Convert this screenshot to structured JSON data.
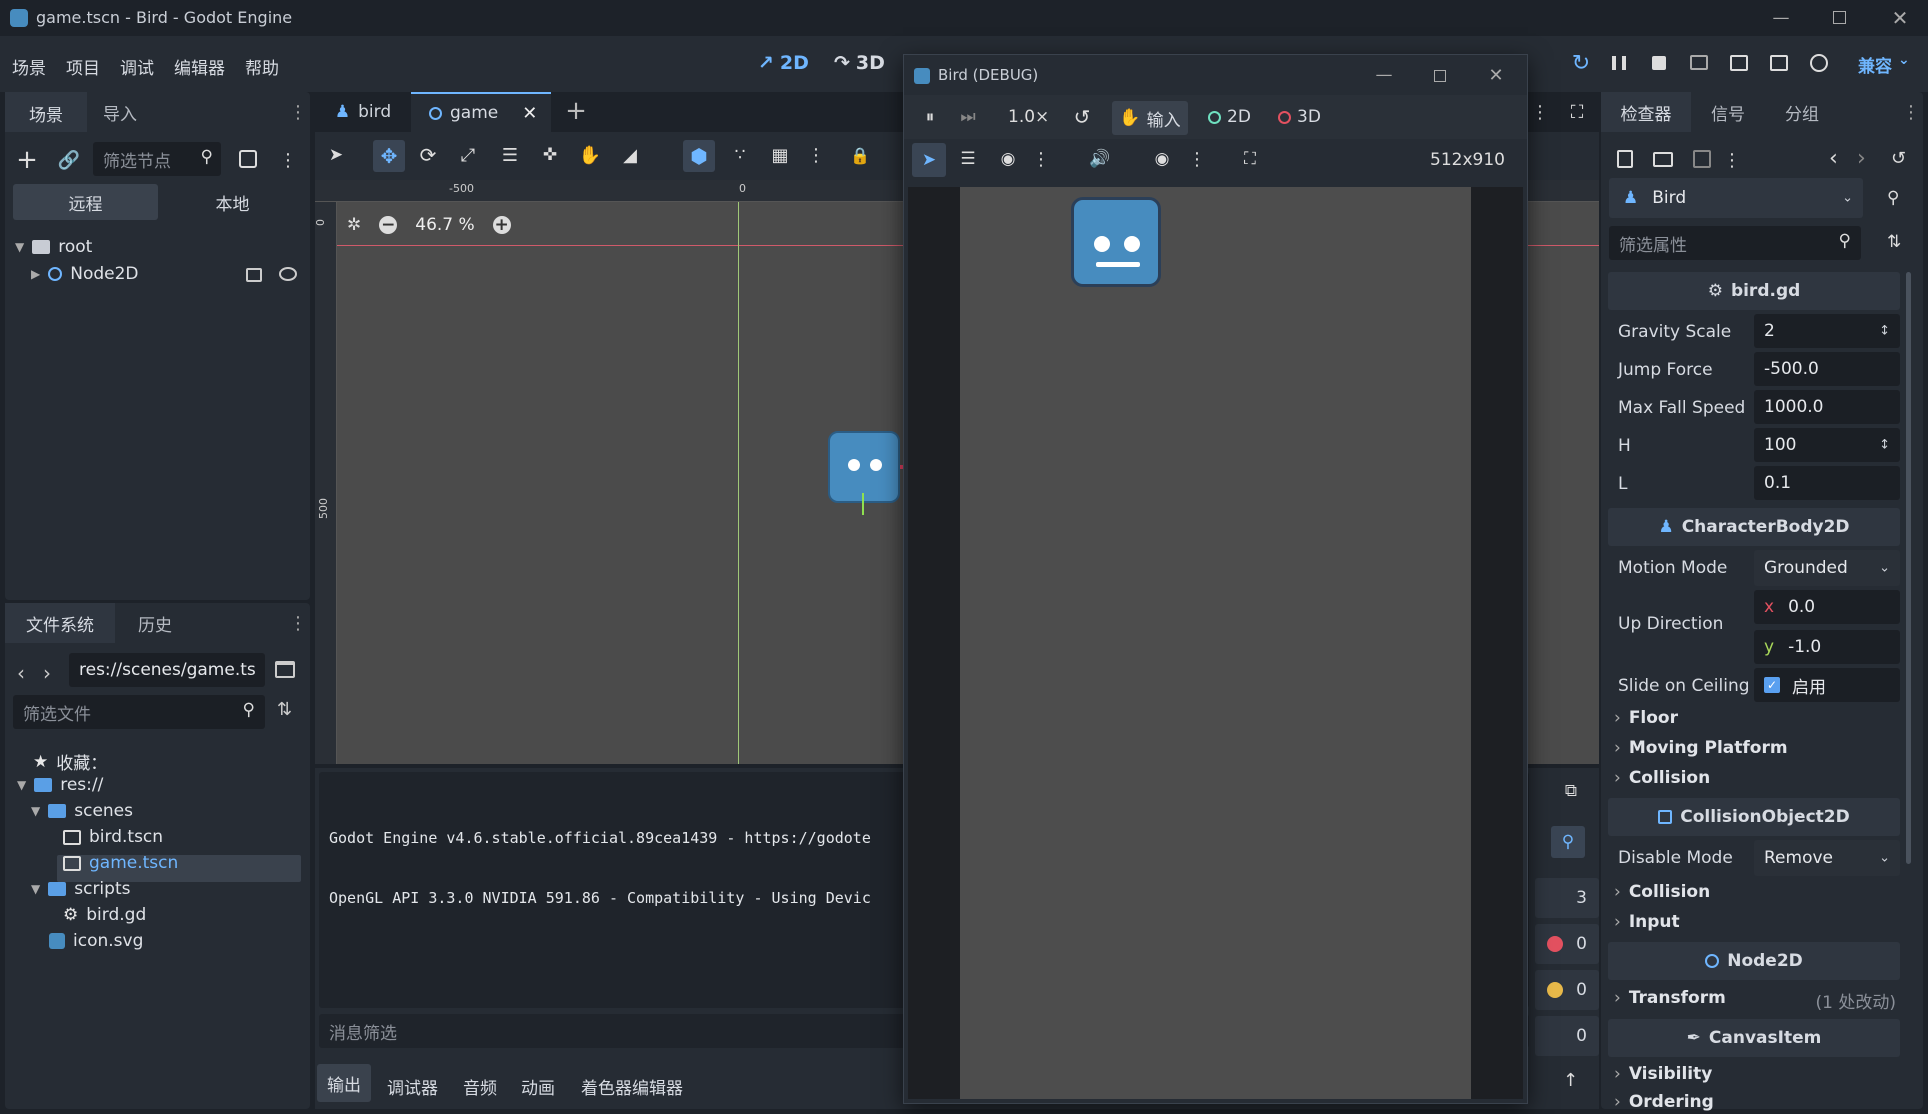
{
  "window": {
    "title": "game.tscn - Bird - Godot Engine"
  },
  "menu": [
    "场景",
    "项目",
    "调试",
    "编辑器",
    "帮助"
  ],
  "modes": {
    "mode2d": "2D",
    "mode3d": "3D"
  },
  "renderer": "兼容",
  "scene_dock": {
    "tabs": [
      "场景",
      "导入"
    ],
    "filter_placeholder": "筛选节点",
    "remote": "远程",
    "local": "本地",
    "nodes": [
      "root",
      "Node2D"
    ]
  },
  "editor_tabs": [
    {
      "label": "bird"
    },
    {
      "label": "game"
    }
  ],
  "viewport": {
    "zoom": "46.7 %",
    "ruler_h": [
      "-500",
      "0"
    ],
    "ruler_v": [
      "0",
      "500"
    ]
  },
  "fs_dock": {
    "tabs": [
      "文件系统",
      "历史"
    ],
    "path": "res://scenes/game.ts",
    "filter_placeholder": "筛选文件",
    "items": [
      "收藏：",
      "res://",
      "scenes",
      "bird.tscn",
      "game.tscn",
      "scripts",
      "bird.gd",
      "icon.svg"
    ]
  },
  "output": {
    "lines": [
      "Godot Engine v4.6.stable.official.89cea1439 - https://godote",
      "OpenGL API 3.3.0 NVIDIA 591.86 - Compatibility - Using Devic"
    ],
    "filter_placeholder": "消息筛选",
    "counts": [
      "3",
      "0",
      "0",
      "0"
    ]
  },
  "bottom_tabs": [
    "输出",
    "调试器",
    "音频",
    "动画",
    "着色器编辑器"
  ],
  "debug_window": {
    "title": "Bird (DEBUG)",
    "speed": "1.0×",
    "input": "输入",
    "mode2d": "2D",
    "mode3d": "3D",
    "resolution": "512x910"
  },
  "inspector": {
    "tabs": [
      "检查器",
      "信号",
      "分组"
    ],
    "object": "Bird",
    "filter_placeholder": "筛选属性",
    "script_section": "bird.gd",
    "props": [
      {
        "label": "Gravity Scale",
        "value": "2"
      },
      {
        "label": "Jump Force",
        "value": "-500.0"
      },
      {
        "label": "Max Fall Speed",
        "value": "1000.0"
      },
      {
        "label": "H",
        "value": "100"
      },
      {
        "label": "L",
        "value": "0.1"
      }
    ],
    "body_section": "CharacterBody2D",
    "motion_mode": {
      "label": "Motion Mode",
      "value": "Grounded"
    },
    "up_direction": {
      "label": "Up Direction",
      "x": "0.0",
      "y": "-1.0",
      "xl": "x",
      "yl": "y"
    },
    "slide": {
      "label": "Slide on Ceiling",
      "value": "启用"
    },
    "groups1": [
      "Floor",
      "Moving Platform",
      "Collision"
    ],
    "co_section": "CollisionObject2D",
    "disable_mode": {
      "label": "Disable Mode",
      "value": "Remove"
    },
    "groups2": [
      "Collision",
      "Input"
    ],
    "node2d_section": "Node2D",
    "transform": {
      "label": "Transform",
      "note": "(1 处改动)"
    },
    "canvas_section": "CanvasItem",
    "groups3": [
      "Visibility",
      "Ordering"
    ]
  },
  "colors": {
    "accent": "#6fb6ff",
    "bg": "#1d2229",
    "panel": "#262c34"
  }
}
